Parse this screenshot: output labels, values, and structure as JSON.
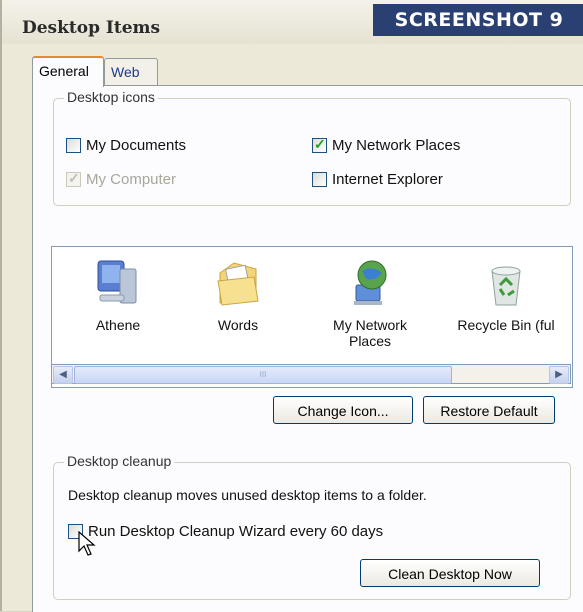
{
  "window": {
    "title": "Desktop Items"
  },
  "badge": "SCREENSHOT 9",
  "tabs": [
    {
      "label": "General",
      "active": true
    },
    {
      "label": "Web",
      "active": false
    }
  ],
  "desktop_icons": {
    "legend": "Desktop icons",
    "items": [
      {
        "label": "My Documents",
        "checked": false,
        "disabled": false
      },
      {
        "label": "My Network Places",
        "checked": true,
        "disabled": false
      },
      {
        "label": "My Computer",
        "checked": true,
        "disabled": true
      },
      {
        "label": "Internet Explorer",
        "checked": false,
        "disabled": false
      }
    ]
  },
  "icon_list": {
    "items": [
      {
        "label": "Athene",
        "icon": "computer-icon"
      },
      {
        "label": "Words",
        "icon": "documents-folder-icon"
      },
      {
        "label": "My Network Places",
        "icon": "network-icon"
      },
      {
        "label": "Recycle Bin (ful",
        "icon": "recycle-bin-icon"
      }
    ],
    "scroll_thumb": "III"
  },
  "buttons": {
    "change_icon": "Change Icon...",
    "restore_default": "Restore Default"
  },
  "cleanup": {
    "legend": "Desktop cleanup",
    "description": "Desktop cleanup moves unused desktop items to a folder.",
    "wizard_checkbox": "Run Desktop Cleanup Wizard every 60 days",
    "wizard_checked": false,
    "clean_now": "Clean Desktop Now"
  },
  "colors": {
    "badge_bg": "#2a3f72",
    "tab_highlight": "#e68b2c",
    "check_green": "#21a121"
  }
}
